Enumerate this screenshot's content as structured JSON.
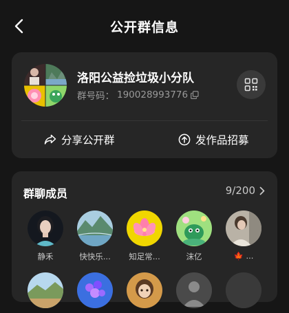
{
  "header": {
    "title": "公开群信息",
    "back_icon": "chevron-left-icon"
  },
  "group": {
    "name": "洛阳公益捡垃圾小分队",
    "id_label": "群号码：",
    "id_value": "190028993776",
    "qr_icon": "qr-code-icon",
    "copy_icon": "copy-icon",
    "actions": {
      "share_label": "分享公开群",
      "share_icon": "share-icon",
      "recruit_label": "发作品招募",
      "recruit_icon": "arrow-up-circle-icon"
    }
  },
  "members": {
    "title": "群聊成员",
    "count": "9/200",
    "items": [
      {
        "name": "静禾"
      },
      {
        "name": "快快乐..."
      },
      {
        "name": "知足常..."
      },
      {
        "name": "沫亿"
      },
      {
        "name": "..."
      },
      {
        "name": ""
      },
      {
        "name": ""
      },
      {
        "name": ""
      },
      {
        "name": ""
      }
    ]
  },
  "colors": {
    "background": "#161616",
    "card": "#262626",
    "text_primary": "#ffffff",
    "text_secondary": "#9a9a9a",
    "avatar_placeholder": "#3a3a3a"
  }
}
